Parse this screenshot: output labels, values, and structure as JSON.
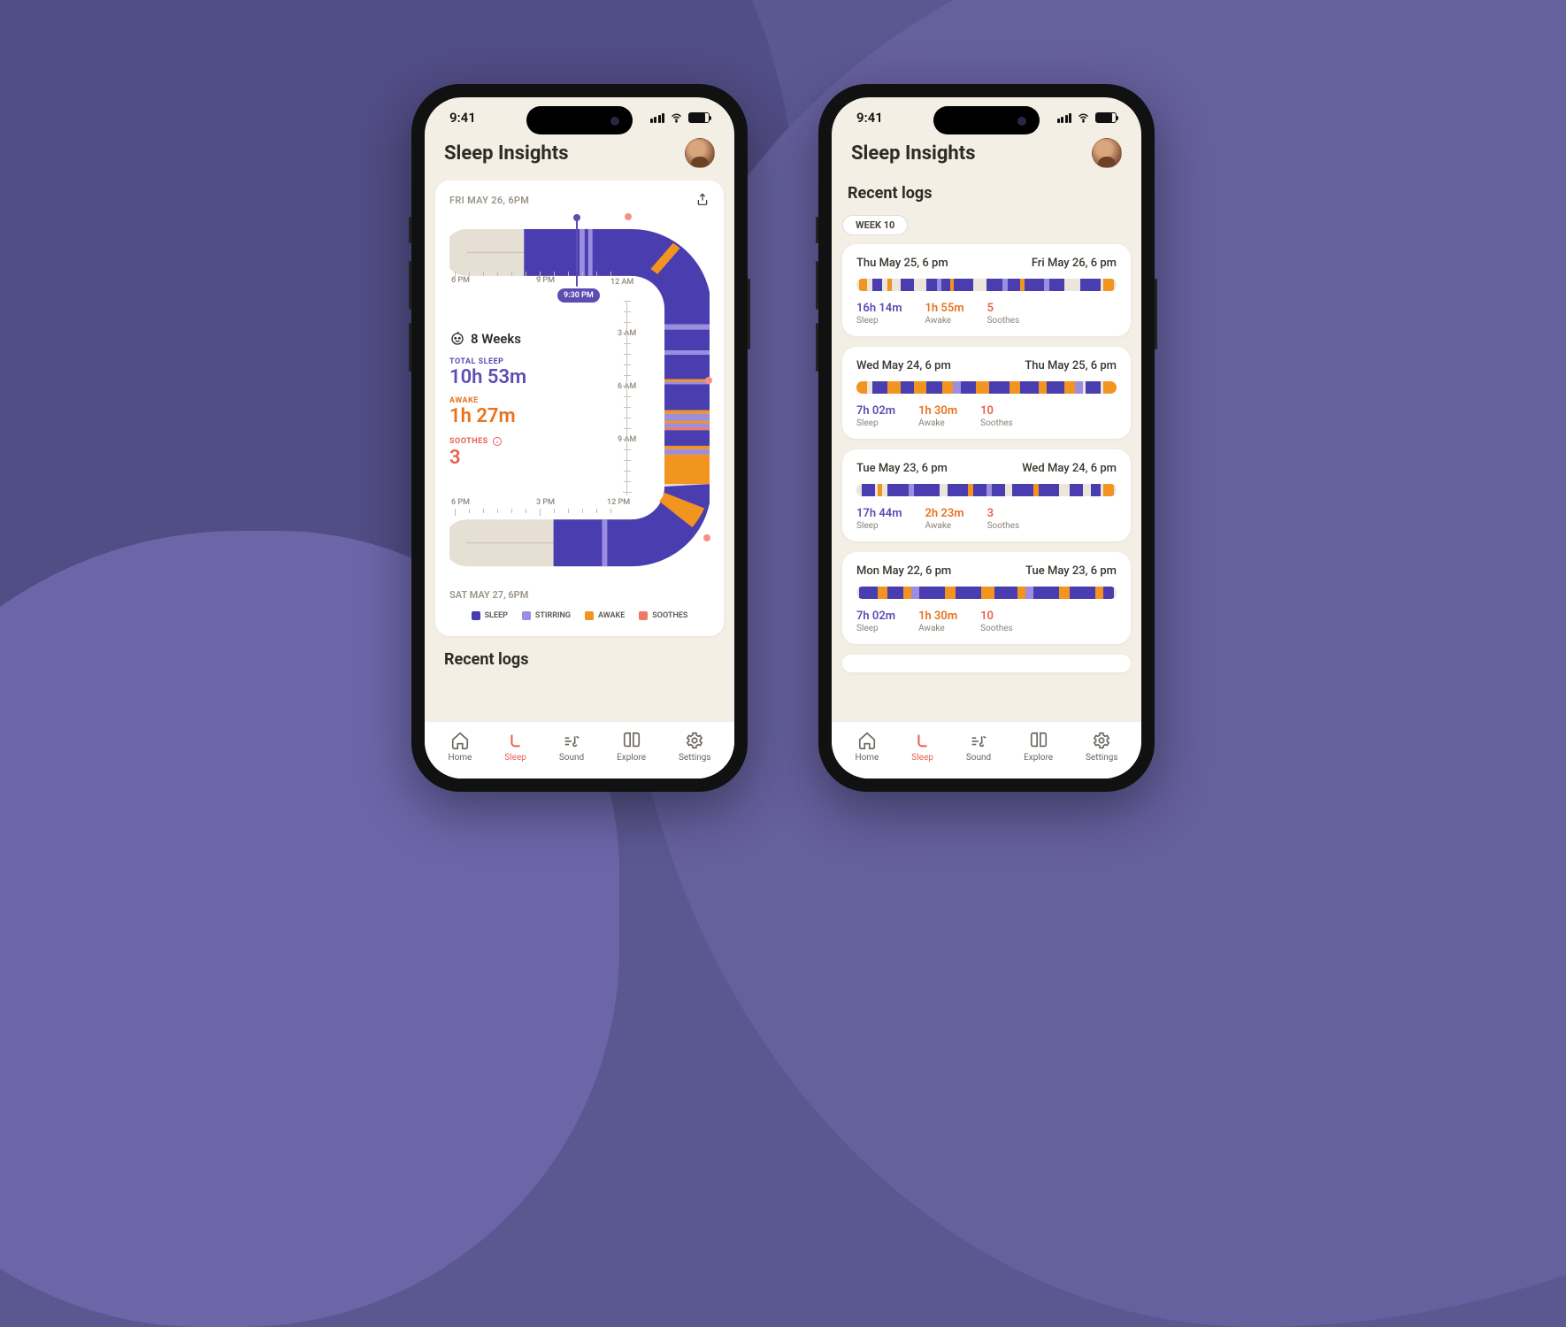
{
  "status": {
    "time": "9:41"
  },
  "header": {
    "title": "Sleep Insights"
  },
  "chart": {
    "top_date": "FRI MAY 26, 6PM",
    "bottom_date": "SAT MAY 27, 6PM",
    "weeks_label": "8 Weeks",
    "marker_time": "9:30 PM",
    "axis_top": {
      "t6pm": "6 PM",
      "t9pm": "9 PM",
      "t12am": "12 AM"
    },
    "axis_right": {
      "t3am": "3 AM",
      "t6am": "6 AM",
      "t9am": "9 AM"
    },
    "axis_bottom": {
      "t12pm": "12 PM",
      "t3pm": "3 PM",
      "t6pm2": "6 PM"
    },
    "stats": {
      "total_sleep_lbl": "TOTAL SLEEP",
      "total_sleep_val": "10h 53m",
      "awake_lbl": "AWAKE",
      "awake_val": "1h 27m",
      "soothes_lbl": "SOOTHES",
      "soothes_val": "3"
    },
    "legend": {
      "sleep": "SLEEP",
      "stirring": "STIRRING",
      "awake": "AWAKE",
      "soothes": "SOOTHES"
    }
  },
  "recent_title": "Recent logs",
  "week_chip": "WEEK 10",
  "logs": [
    {
      "start": "Thu May 25, 6 pm",
      "end": "Fri May 26, 6 pm",
      "sleep": "16h 14m",
      "awake": "1h 55m",
      "soothes": "5"
    },
    {
      "start": "Wed May 24, 6 pm",
      "end": "Thu May 25, 6 pm",
      "sleep": "7h 02m",
      "awake": "1h 30m",
      "soothes": "10"
    },
    {
      "start": "Tue May 23, 6 pm",
      "end": "Wed May 24, 6 pm",
      "sleep": "17h 44m",
      "awake": "2h 23m",
      "soothes": "3"
    },
    {
      "start": "Mon May 22, 6 pm",
      "end": "Tue May 23, 6 pm",
      "sleep": "7h 02m",
      "awake": "1h 30m",
      "soothes": "10"
    }
  ],
  "log_labels": {
    "sleep": "Sleep",
    "awake": "Awake",
    "soothes": "Soothes"
  },
  "tabs": {
    "home": "Home",
    "sleep": "Sleep",
    "sound": "Sound",
    "explore": "Explore",
    "settings": "Settings"
  },
  "chart_data": {
    "type": "bar",
    "description": "24h sleep log rendered along a U-shaped track; color bands encode state over time.",
    "time_range_hours": 24,
    "axis_ticks": [
      "6 PM",
      "9 PM",
      "12 AM",
      "3 AM",
      "6 AM",
      "9 AM",
      "12 PM",
      "3 PM",
      "6 PM"
    ],
    "legend": [
      "SLEEP",
      "STIRRING",
      "AWAKE",
      "SOOTHES"
    ],
    "marker": "9:30 PM",
    "totals": {
      "sleep_minutes": 653,
      "awake_minutes": 87,
      "soothes_count": 3
    },
    "series_colors": {
      "SLEEP": "#4a3db0",
      "STIRRING": "#9b8de0",
      "AWAKE": "#f29420",
      "SOOTHES": "#ee7968"
    }
  }
}
